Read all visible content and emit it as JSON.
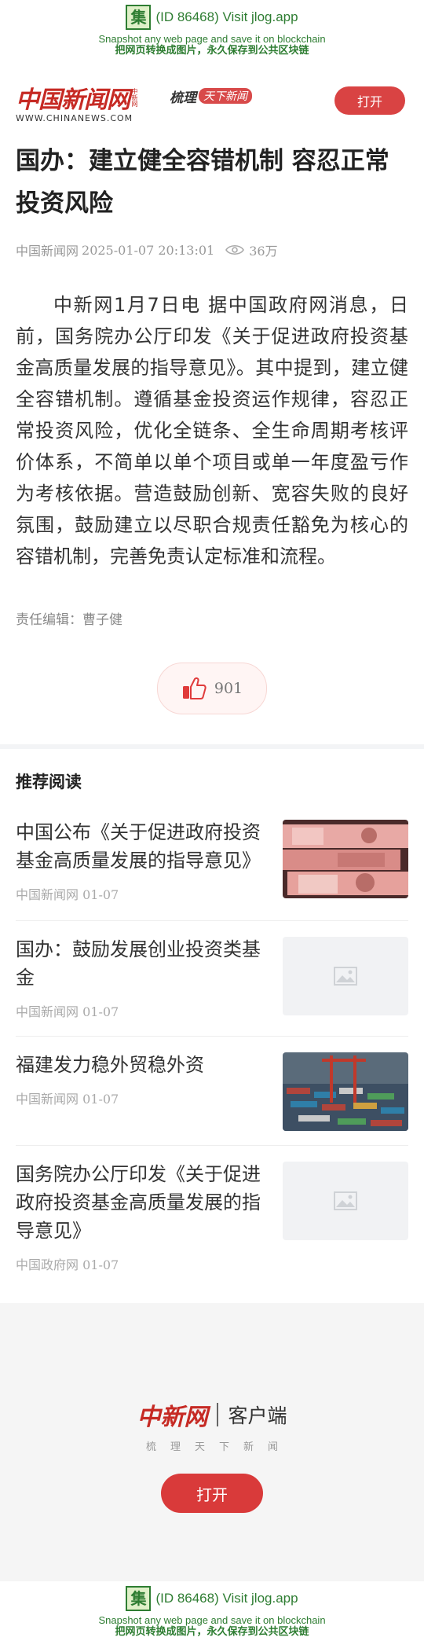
{
  "banner": {
    "icon_char": "集",
    "id_text": "(ID 86468) Visit jlog.app",
    "line2": "Snapshot any web page and save it on blockchain",
    "line3": "把网页转换成图片，永久保存到公共区块链"
  },
  "header": {
    "logo_cn": "中国新闻网",
    "logo_tag": "中新网",
    "logo_en": "WWW.CHINANEWS.COM",
    "slogan_a": "梳理",
    "slogan_b": "天下新闻",
    "open_label": "打开"
  },
  "article": {
    "title": "国办：建立健全容错机制 容忍正常投资风险",
    "source": "中国新闻网",
    "date": "2025-01-07 20:13:01",
    "views": "36万",
    "body": "中新网1月7日电 据中国政府网消息，日前，国务院办公厅印发《关于促进政府投资基金高质量发展的指导意见》。其中提到，建立健全容错机制。遵循基金投资运作规律，容忍正常投资风险，优化全链条、全生命周期考核评价体系，不简单以单个项目或单一年度盈亏作为考核依据。营造鼓励创新、宽容失败的良好氛围，鼓励建立以尽职合规责任豁免为核心的容错机制，完善免责认定标准和流程。",
    "editor": "责任编辑：曹子健",
    "likes": "901"
  },
  "recommend": {
    "heading": "推荐阅读",
    "items": [
      {
        "title": "中国公布《关于促进政府投资基金高质量发展的指导意见》",
        "source": "中国新闻网 01-07",
        "thumb": "currency-photo"
      },
      {
        "title": "国办：鼓励发展创业投资类基金",
        "source": "中国新闻网 01-07",
        "thumb": "placeholder"
      },
      {
        "title": "福建发力稳外贸稳外资",
        "source": "中国新闻网 01-07",
        "thumb": "port-photo"
      },
      {
        "title": "国务院办公厅印发《关于促进政府投资基金高质量发展的指导意见》",
        "source": "中国政府网 01-07",
        "thumb": "placeholder"
      }
    ]
  },
  "footer": {
    "logo_cn": "中新网",
    "client_label": "客户端",
    "tagline": "梳理天下新闻",
    "open_label": "打开"
  },
  "colors": {
    "brand_red": "#c62a24",
    "button_red": "#d94343",
    "banner_green": "#2e7d32"
  }
}
